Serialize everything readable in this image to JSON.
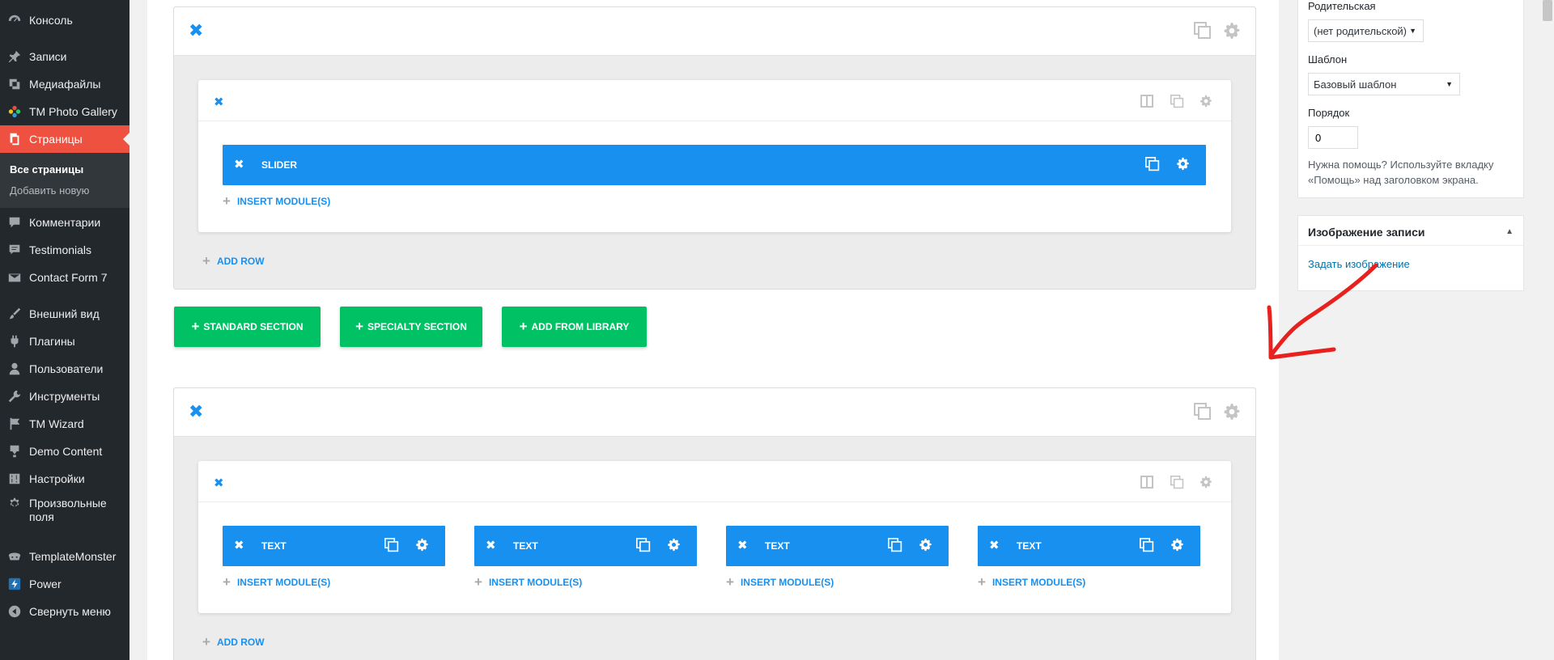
{
  "admin_menu": {
    "items": [
      {
        "label": "Консоль",
        "icon": "dashboard-icon"
      },
      {
        "label": "Записи",
        "icon": "pin-icon"
      },
      {
        "label": "Медиафайлы",
        "icon": "media-icon"
      },
      {
        "label": "TM Photo Gallery",
        "icon": "gallery-flower-icon"
      },
      {
        "label": "Страницы",
        "icon": "pages-icon"
      },
      {
        "label": "Комментарии",
        "icon": "comment-icon"
      },
      {
        "label": "Testimonials",
        "icon": "testimonial-icon"
      },
      {
        "label": "Contact Form 7",
        "icon": "mail-icon"
      },
      {
        "label": "Внешний вид",
        "icon": "brush-icon"
      },
      {
        "label": "Плагины",
        "icon": "plugin-icon"
      },
      {
        "label": "Пользователи",
        "icon": "user-icon"
      },
      {
        "label": "Инструменты",
        "icon": "wrench-icon"
      },
      {
        "label": "TM Wizard",
        "icon": "flag-icon"
      },
      {
        "label": "Demo Content",
        "icon": "download-icon"
      },
      {
        "label": "Настройки",
        "icon": "settings-sliders-icon"
      },
      {
        "label": "Произвольные поля",
        "icon": "gear-icon"
      },
      {
        "label": "TemplateMonster",
        "icon": "templatemonster-icon"
      },
      {
        "label": "Power",
        "icon": "power-icon"
      },
      {
        "label": "Свернуть меню",
        "icon": "collapse-icon"
      }
    ],
    "submenu": [
      "Все страницы",
      "Добавить новую"
    ]
  },
  "builder": {
    "module_slider": "SLIDER",
    "module_text": "TEXT",
    "insert_module": "INSERT MODULE(S)",
    "add_row": "ADD ROW",
    "buttons": {
      "standard": "STANDARD SECTION",
      "specialty": "SPECIALTY SECTION",
      "library": "ADD FROM LIBRARY"
    },
    "colors": {
      "module": "#1890f0",
      "green": "#00c265",
      "current_menu": "#ef5140"
    }
  },
  "page_attributes": {
    "parent_label": "Родительская",
    "parent_value": "(нет родительской)",
    "template_label": "Шаблон",
    "template_value": "Базовый шаблон",
    "order_label": "Порядок",
    "order_value": "0",
    "help_text": "Нужна помощь? Используйте вкладку «Помощь» над заголовком экрана."
  },
  "featured_image": {
    "title": "Изображение записи",
    "link": "Задать изображение"
  }
}
